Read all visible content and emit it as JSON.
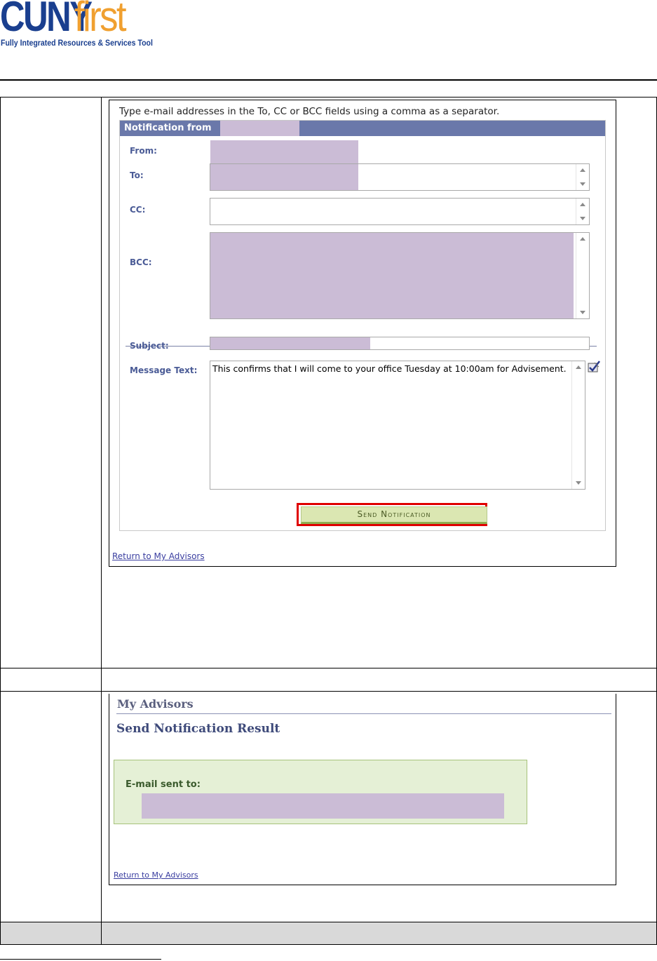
{
  "logo": {
    "brand_part1": "CUNY",
    "brand_part2": "first",
    "tagline": "Fully Integrated Resources & Services Tool",
    "colors": {
      "cuny": "#1a3f8f",
      "first": "#f0a030"
    }
  },
  "notification_form": {
    "instruction": "Type e-mail addresses in the To, CC or BCC fields using a comma as a separator.",
    "panel_title": "Notification from",
    "labels": {
      "from": "From:",
      "to": "To:",
      "cc": "CC:",
      "bcc": "BCC:",
      "subject": "Subject:",
      "message": "Message Text:"
    },
    "message_text": "This confirms that I will come to your office Tuesday at 10:00am for Advisement.",
    "send_button": "Send Notification",
    "return_link": "Return to My Advisors",
    "spellcheck_icon": "spellcheck-icon"
  },
  "result_page": {
    "title": "My Advisors",
    "subtitle": "Send Notification Result",
    "email_sent_label": "E-mail sent to:",
    "return_link": "Return to My Advisors"
  },
  "colors": {
    "redaction": "#cbbcd6",
    "panel_header": "#6a78aa",
    "highlight_outline": "#e00000",
    "button_bg": "#dbe7b2",
    "result_box_bg": "#e5f0d6"
  }
}
